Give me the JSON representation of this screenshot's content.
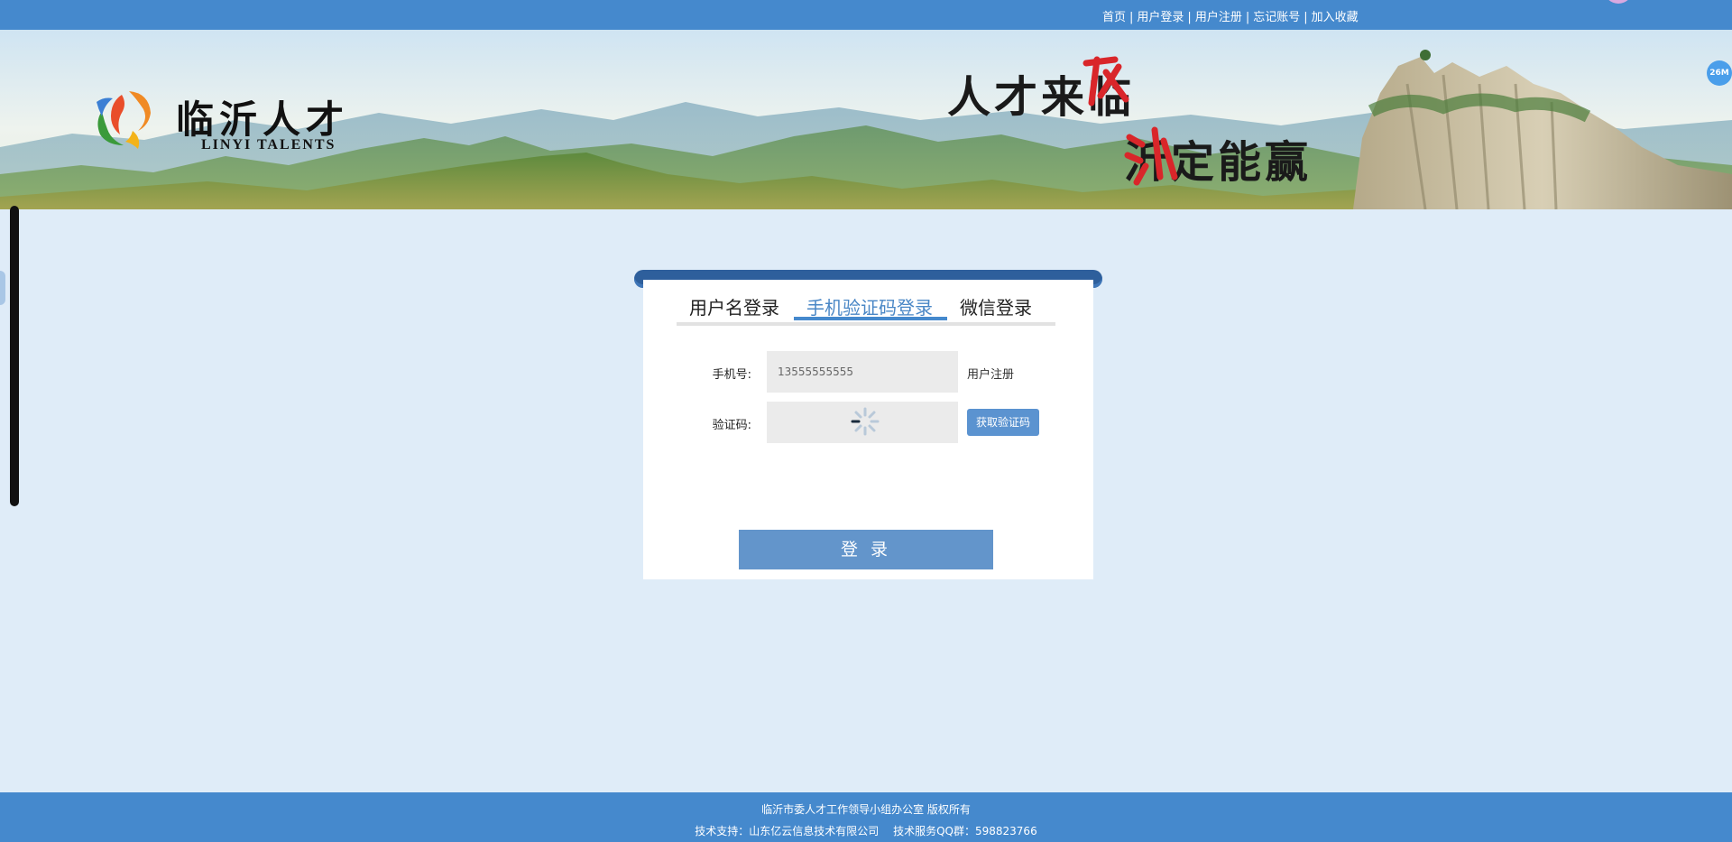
{
  "topnav": {
    "links": [
      "首页",
      "用户登录",
      "用户注册",
      "忘记账号",
      "加入收藏"
    ],
    "separator": "|"
  },
  "banner": {
    "logo_cn": "临沂人才",
    "logo_en": "LINYI TALENTS",
    "slogan_line1": "人才来临",
    "slogan_line2": "沂定能赢"
  },
  "float_badge": "26M",
  "login": {
    "tabs": [
      "用户名登录",
      "手机验证码登录",
      "微信登录"
    ],
    "active_tab": "手机验证码登录",
    "phone_label": "手机号:",
    "phone_value": "13555555555",
    "register_link": "用户注册",
    "code_label": "验证码:",
    "get_code_button": "获取验证码",
    "submit_button": "登 录"
  },
  "footer": {
    "line1": "临沂市委人才工作领导小组办公室 版权所有",
    "line2": "技术支持：山东亿云信息技术有限公司　 技术服务QQ群：598823766"
  },
  "colors": {
    "header_blue": "#4589cd",
    "page_bg": "#dfecf8",
    "button_blue": "#6395cb",
    "active_tab": "#4a87c6"
  }
}
